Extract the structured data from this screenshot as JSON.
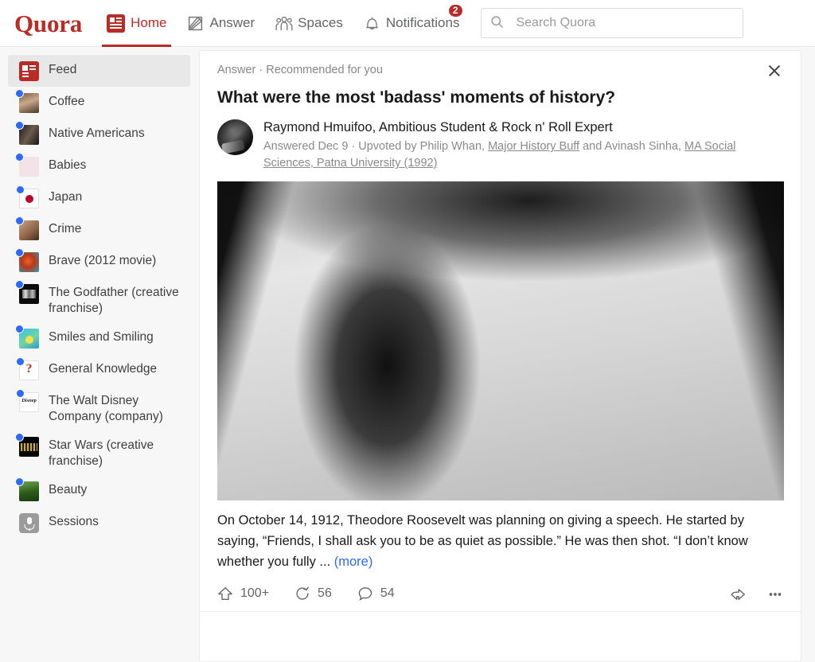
{
  "brand": {
    "name": "Quora",
    "color": "#b92b27"
  },
  "topnav": {
    "items": [
      {
        "label": "Home",
        "icon": "home-icon",
        "active": true
      },
      {
        "label": "Answer",
        "icon": "answer-pencil-icon",
        "active": false
      },
      {
        "label": "Spaces",
        "icon": "spaces-people-icon",
        "active": false
      },
      {
        "label": "Notifications",
        "icon": "bell-icon",
        "active": false,
        "badge": "2"
      }
    ]
  },
  "search": {
    "placeholder": "Search Quora",
    "value": "",
    "icon": "search-icon"
  },
  "sidebar": {
    "items": [
      {
        "label": "Feed",
        "thumb": "t-feed",
        "dot": false,
        "selected": true
      },
      {
        "label": "Coffee",
        "thumb": "t-coffee",
        "dot": true,
        "selected": false
      },
      {
        "label": "Native Americans",
        "thumb": "t-native",
        "dot": true,
        "selected": false
      },
      {
        "label": "Babies",
        "thumb": "t-babies",
        "dot": true,
        "selected": false
      },
      {
        "label": "Japan",
        "thumb": "t-japan",
        "dot": true,
        "selected": false
      },
      {
        "label": "Crime",
        "thumb": "t-crime",
        "dot": true,
        "selected": false
      },
      {
        "label": "Brave (2012 movie)",
        "thumb": "t-brave",
        "dot": true,
        "selected": false
      },
      {
        "label": "The Godfather (creative franchise)",
        "thumb": "t-godfather",
        "dot": true,
        "selected": false
      },
      {
        "label": "Smiles and Smiling",
        "thumb": "t-smiles",
        "dot": true,
        "selected": false
      },
      {
        "label": "General Knowledge",
        "thumb": "t-general",
        "dot": true,
        "selected": false
      },
      {
        "label": "The Walt Disney Company (company)",
        "thumb": "t-disney",
        "dot": true,
        "selected": false
      },
      {
        "label": "Star Wars (creative franchise)",
        "thumb": "t-starwars",
        "dot": true,
        "selected": false
      },
      {
        "label": "Beauty",
        "thumb": "t-beauty",
        "dot": true,
        "selected": false
      },
      {
        "label": "Sessions",
        "thumb": "t-sessions",
        "dot": false,
        "selected": false
      }
    ]
  },
  "post": {
    "meta": "Answer · Recommended for you",
    "close_icon": "close-icon",
    "question": "What were the most 'badass' moments of history?",
    "author": {
      "name": "Raymond Hmuifoo, Ambitious Student & Rock n' Roll Expert",
      "avatar": "author-avatar"
    },
    "answered_prefix": "Answered Dec 9 · Upvoted by ",
    "upvoter1_name": "Philip Whan, ",
    "upvoter1_credential": "Major History Buff",
    "upvoter_conjunction": " and ",
    "upvoter2_name": "Avinash Sinha, ",
    "upvoter2_credential": "MA Social Sciences, Patna University (1992)",
    "image_alt": "black-and-white photo of bloodstained shirt",
    "body": "On October 14, 1912, Theodore Roosevelt was planning on giving a speech. He started by saying, “Friends, I shall ask you to be as quiet as possible.” He was then shot. “I don’t know whether you fully ... ",
    "more_label": "(more)",
    "actions": {
      "upvote": {
        "icon": "upvote-arrow-icon",
        "count": "100+"
      },
      "repost": {
        "icon": "repost-circular-arrow-icon",
        "count": "56"
      },
      "comment": {
        "icon": "comment-bubble-icon",
        "count": "54"
      },
      "share": {
        "icon": "share-arrow-icon"
      },
      "more": {
        "icon": "more-dots-icon"
      }
    }
  }
}
